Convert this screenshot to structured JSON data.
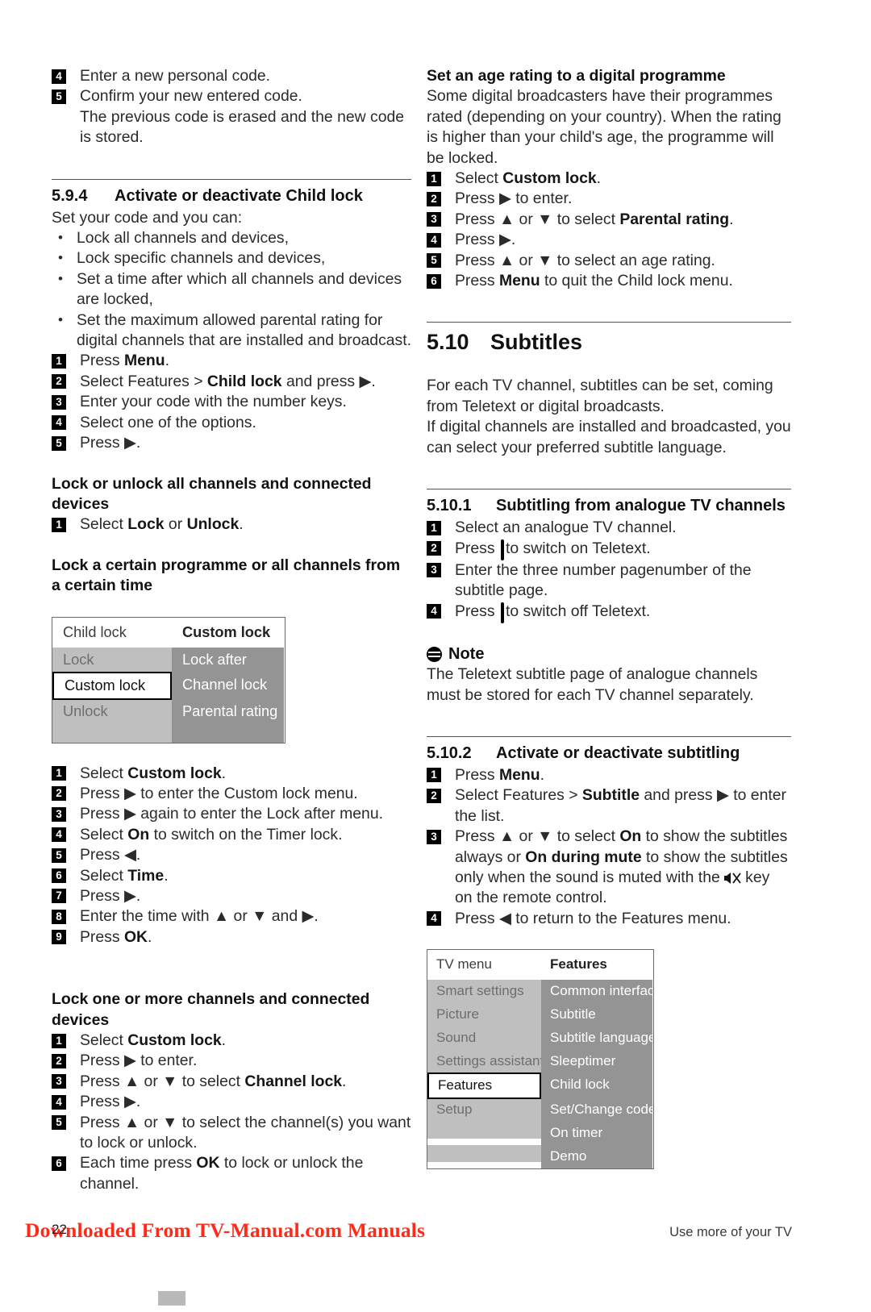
{
  "left_column": {
    "top_steps": [
      {
        "n": "4",
        "text": "Enter a new personal code."
      },
      {
        "n": "5",
        "text": "Confirm your new entered code."
      }
    ],
    "top_continuation": "The previous code is erased and the new code is stored.",
    "section_594": {
      "number": "5.9.4",
      "title": "Activate or deactivate Child lock",
      "intro": "Set your code and you can:",
      "bullets": [
        "Lock all channels and devices,",
        "Lock specific channels and devices,",
        "Set a time after which all channels and devices are locked,",
        "Set the maximum allowed parental rating for digital channels that are installed and broadcast."
      ],
      "steps": [
        {
          "n": "1",
          "pre": "Press ",
          "bold": "Menu",
          "post": "."
        },
        {
          "n": "2",
          "pre": "Select Features > ",
          "bold": "Child lock",
          "post": " and press ▶."
        },
        {
          "n": "3",
          "pre": "Enter your code with the number keys.",
          "bold": "",
          "post": ""
        },
        {
          "n": "4",
          "pre": "Select one of the options.",
          "bold": "",
          "post": ""
        },
        {
          "n": "5",
          "pre": "Press ▶.",
          "bold": "",
          "post": ""
        }
      ]
    },
    "lock_all": {
      "heading": "Lock or unlock all channels and connected devices",
      "steps": [
        {
          "n": "1",
          "pre": "Select ",
          "bold": "Lock",
          "mid": " or ",
          "bold2": "Unlock",
          "post": "."
        }
      ]
    },
    "lock_certain": {
      "heading": "Lock a certain programme or all channels from a certain time",
      "steps": [
        {
          "n": "1",
          "pre": "Select ",
          "bold": "Custom lock",
          "post": "."
        },
        {
          "n": "2",
          "pre": "Press ▶ to enter the Custom lock menu.",
          "bold": "",
          "post": ""
        },
        {
          "n": "3",
          "pre": "Press ▶ again to enter the Lock after menu.",
          "bold": "",
          "post": ""
        },
        {
          "n": "4",
          "pre": "Select ",
          "bold": "On",
          "post": " to switch on the Timer lock."
        },
        {
          "n": "5",
          "pre": "Press ◀.",
          "bold": "",
          "post": ""
        },
        {
          "n": "6",
          "pre": "Select ",
          "bold": "Time",
          "post": "."
        },
        {
          "n": "7",
          "pre": "Press ▶.",
          "bold": "",
          "post": ""
        },
        {
          "n": "8",
          "pre": "Enter the time with ▲ or ▼ and ▶.",
          "bold": "",
          "post": ""
        },
        {
          "n": "9",
          "pre": "Press ",
          "bold": "OK",
          "post": "."
        }
      ]
    },
    "lock_one_more": {
      "heading": "Lock one or more channels and connected devices",
      "steps": [
        {
          "n": "1",
          "pre": "Select ",
          "bold": "Custom lock",
          "post": "."
        },
        {
          "n": "2",
          "pre": "Press ▶ to enter.",
          "bold": "",
          "post": ""
        },
        {
          "n": "3",
          "pre": "Press ▲ or ▼ to select ",
          "bold": "Channel lock",
          "post": "."
        },
        {
          "n": "4",
          "pre": "Press ▶.",
          "bold": "",
          "post": ""
        },
        {
          "n": "5",
          "pre": "Press ▲ or ▼ to select the channel(s) you want to lock or unlock.",
          "bold": "",
          "post": ""
        },
        {
          "n": "6",
          "pre": "Each time press ",
          "bold": "OK",
          "post": " to lock or unlock the channel."
        }
      ]
    },
    "childlock_table": {
      "header": {
        "left": "Child lock",
        "right": "Custom lock"
      },
      "rows": [
        {
          "left": "Lock",
          "right": "Lock after",
          "selected": false
        },
        {
          "left": "Custom lock",
          "right": "Channel lock",
          "selected": true
        },
        {
          "left": "Unlock",
          "right": "Parental rating",
          "selected": false
        },
        {
          "left": "",
          "right": "",
          "selected": false
        }
      ]
    }
  },
  "right_column": {
    "age_rating": {
      "heading": "Set an age rating to a digital programme",
      "paragraph": "Some digital broadcasters have their programmes rated (depending on your country). When the rating is higher than your child's age, the programme will be locked.",
      "steps": [
        {
          "n": "1",
          "pre": "Select ",
          "bold": "Custom lock",
          "post": "."
        },
        {
          "n": "2",
          "pre": "Press ▶ to enter.",
          "bold": "",
          "post": ""
        },
        {
          "n": "3",
          "pre": "Press ▲ or ▼ to select ",
          "bold": "Parental rating",
          "post": "."
        },
        {
          "n": "4",
          "pre": "Press ▶.",
          "bold": "",
          "post": ""
        },
        {
          "n": "5",
          "pre": "Press ▲ or ▼ to select an age rating.",
          "bold": "",
          "post": ""
        },
        {
          "n": "6",
          "pre": "Press ",
          "bold": "Menu",
          "post": " to quit the Child lock menu."
        }
      ]
    },
    "section_510": {
      "number": "5.10",
      "title": "Subtitles",
      "paragraph1": "For each TV channel, subtitles can be set, coming from Teletext or digital broadcasts.",
      "paragraph2": "If digital channels are installed and broadcasted, you can select your preferred subtitle language."
    },
    "section_5101": {
      "number": "5.10.1",
      "title": "Subtitling from analogue TV channels",
      "steps": [
        {
          "n": "1",
          "text": "Select an analogue TV channel."
        },
        {
          "n": "2",
          "text_pre": "Press ",
          "icon": "teletext-icon",
          "text_post": " to switch on Teletext."
        },
        {
          "n": "3",
          "text": "Enter the three number pagenumber of the subtitle page."
        },
        {
          "n": "4",
          "text_pre": "Press ",
          "icon": "teletext-icon",
          "text_post": " to switch off Teletext."
        }
      ]
    },
    "note": {
      "icon": "note-icon",
      "label": "Note",
      "text": "The Teletext subtitle page of analogue channels must be stored for each TV channel separately."
    },
    "section_5102": {
      "number": "5.10.2",
      "title": "Activate or deactivate subtitling",
      "steps": [
        {
          "n": "1",
          "pre": "Press ",
          "bold": "Menu",
          "post": "."
        },
        {
          "n": "2",
          "pre": "Select Features > ",
          "bold": "Subtitle",
          "post": " and press ▶ to enter the list."
        },
        {
          "n": "3",
          "pre": "Press ▲ or ▼ to select ",
          "bold": "On",
          "mid": " to show the subtitles always or ",
          "bold2": "On during mute",
          "post": " to show the subtitles only when the sound is muted with the",
          "icon": "mute-icon",
          "tail": "key on the remote control."
        },
        {
          "n": "4",
          "pre": "Press ◀ to return to the Features menu.",
          "bold": "",
          "post": ""
        }
      ]
    },
    "tvmenu_table": {
      "header": {
        "left": "TV menu",
        "right": "Features"
      },
      "rows": [
        {
          "left": "Smart settings",
          "right": "Common interface",
          "selected": false
        },
        {
          "left": "Picture",
          "right": "Subtitle",
          "selected": false
        },
        {
          "left": "Sound",
          "right": "Subtitle language",
          "selected": false
        },
        {
          "left": "Settings assistant",
          "right": "Sleeptimer",
          "selected": false
        },
        {
          "left": "Features",
          "right": "Child lock",
          "selected": true
        },
        {
          "left": "Setup",
          "right": "Set/Change code",
          "selected": false
        },
        {
          "left": "",
          "right": "On timer",
          "selected": false
        },
        {
          "left": "",
          "right": "Demo",
          "selected": false
        }
      ]
    }
  },
  "footer": {
    "watermark": "Downloaded From TV-Manual.com Manuals",
    "page_number": "22",
    "right_text": "Use more of your TV"
  }
}
